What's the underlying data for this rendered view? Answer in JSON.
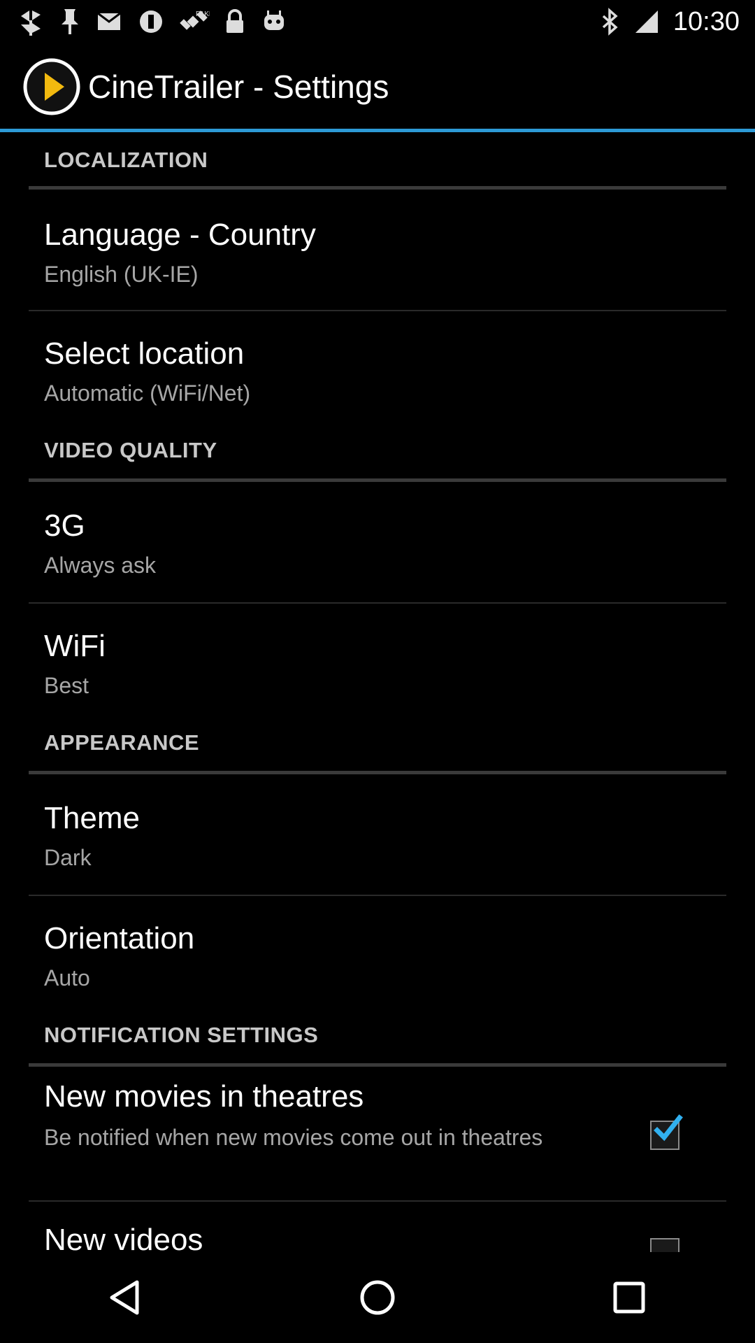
{
  "status_bar": {
    "time": "10:30",
    "left_icons": [
      "pinwheel-icon",
      "pin-icon",
      "mail-icon",
      "block-icon",
      "satellite-icon",
      "lock-icon",
      "android-icon"
    ],
    "right_icons": [
      "bluetooth-icon",
      "signal-icon"
    ]
  },
  "app_bar": {
    "title": "CineTrailer - Settings",
    "logo_icon": "play-circle-icon",
    "accent_color": "#2d9ad6"
  },
  "sections": [
    {
      "title": "LOCALIZATION",
      "items": [
        {
          "title": "Language - Country",
          "summary": "English (UK-IE)"
        },
        {
          "title": "Select location",
          "summary": "Automatic (WiFi/Net)"
        }
      ]
    },
    {
      "title": "VIDEO QUALITY",
      "items": [
        {
          "title": "3G",
          "summary": "Always ask"
        },
        {
          "title": "WiFi",
          "summary": "Best"
        }
      ]
    },
    {
      "title": "APPEARANCE",
      "items": [
        {
          "title": "Theme",
          "summary": "Dark"
        },
        {
          "title": "Orientation",
          "summary": "Auto"
        }
      ]
    },
    {
      "title": "NOTIFICATION SETTINGS",
      "items": [
        {
          "title": "New movies in theatres",
          "summary": "Be notified when new movies come out in theatres",
          "checked": true
        },
        {
          "title": "New videos",
          "summary": ""
        }
      ]
    }
  ],
  "nav_bar": {
    "icons": [
      "back-icon",
      "home-icon",
      "recents-icon"
    ]
  }
}
